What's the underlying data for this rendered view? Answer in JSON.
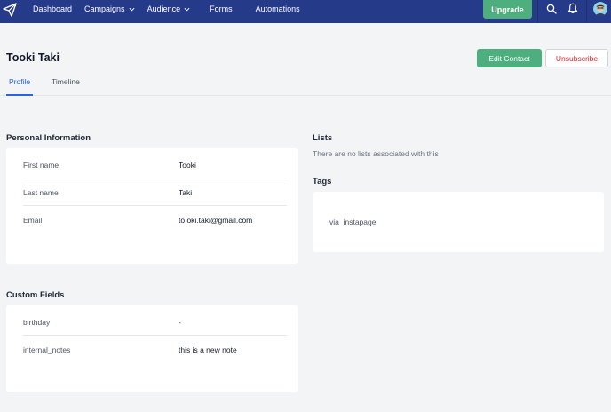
{
  "nav": {
    "items": [
      {
        "label": "Dashboard",
        "dropdown": false
      },
      {
        "label": "Campaigns",
        "dropdown": true
      },
      {
        "label": "Audience",
        "dropdown": true
      },
      {
        "label": "Forms",
        "dropdown": false
      },
      {
        "label": "Automations",
        "dropdown": false
      }
    ],
    "upgrade_label": "Upgrade",
    "icons": [
      "paper-plane-logo-icon",
      "search-icon",
      "bell-icon",
      "avatar"
    ]
  },
  "contact": {
    "name": "Tooki Taki",
    "edit_label": "Edit Contact",
    "unsubscribe_label": "Unsubscribe"
  },
  "tabs": [
    {
      "label": "Profile",
      "active": true
    },
    {
      "label": "Timeline",
      "active": false
    }
  ],
  "personal_info": {
    "title": "Personal Information",
    "rows": [
      {
        "key": "First name",
        "value": "Tooki"
      },
      {
        "key": "Last name",
        "value": "Taki"
      },
      {
        "key": "Email",
        "value": "to.oki.taki@gmail.com"
      }
    ]
  },
  "custom_fields": {
    "title": "Custom Fields",
    "rows": [
      {
        "key": "birthday",
        "value": "-"
      },
      {
        "key": "internal_notes",
        "value": "this is a new note"
      }
    ]
  },
  "lists": {
    "title": "Lists",
    "empty_text": "There are no lists associated with this"
  },
  "tags": {
    "title": "Tags",
    "items": [
      "via_instapage"
    ]
  },
  "colors": {
    "nav_bg": "#263a8a",
    "accent_green": "#4caf7d",
    "link_blue": "#2563eb",
    "danger_red": "#dc2626",
    "page_bg": "#f3f4f6"
  }
}
